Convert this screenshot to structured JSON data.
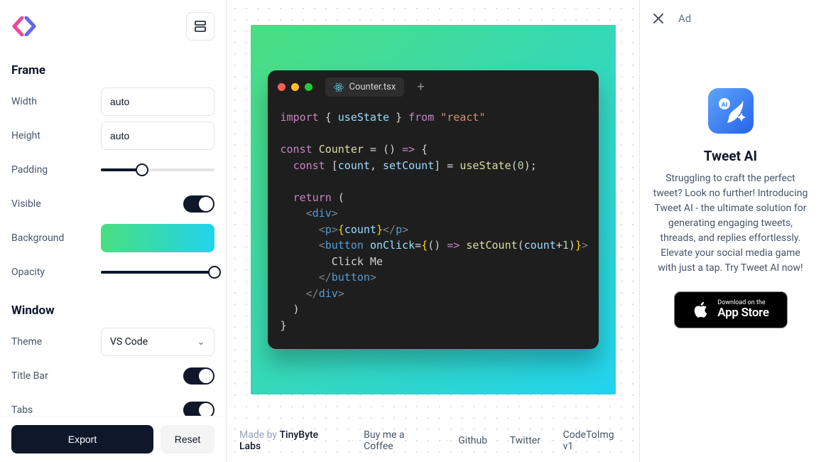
{
  "sidebar": {
    "frame": {
      "heading": "Frame",
      "width": {
        "label": "Width",
        "value": "auto"
      },
      "height": {
        "label": "Height",
        "value": "auto"
      },
      "padding": {
        "label": "Padding",
        "pct": 36
      },
      "visible": {
        "label": "Visible",
        "on": true
      },
      "background": {
        "label": "Background"
      },
      "opacity": {
        "label": "Opacity",
        "pct": 100
      }
    },
    "window": {
      "heading": "Window",
      "theme": {
        "label": "Theme",
        "value": "VS Code"
      },
      "titlebar": {
        "label": "Title Bar",
        "on": true
      },
      "tabs": {
        "label": "Tabs",
        "on": true
      }
    },
    "export": "Export",
    "reset": "Reset"
  },
  "editor": {
    "filename": "Counter.tsx",
    "code_tokens": [
      [
        [
          "kw",
          "import"
        ],
        [
          "pn",
          " { "
        ],
        [
          "id",
          "useState"
        ],
        [
          "pn",
          " } "
        ],
        [
          "kw",
          "from"
        ],
        [
          "pn",
          " "
        ],
        [
          "str",
          "\"react\""
        ]
      ],
      [],
      [
        [
          "kw",
          "const"
        ],
        [
          "pn",
          " "
        ],
        [
          "fn",
          "Counter"
        ],
        [
          "pn",
          " = () "
        ],
        [
          "kw",
          "=>"
        ],
        [
          "pn",
          " {"
        ]
      ],
      [
        [
          "pn",
          "  "
        ],
        [
          "kw",
          "const"
        ],
        [
          "pn",
          " ["
        ],
        [
          "id",
          "count"
        ],
        [
          "pn",
          ", "
        ],
        [
          "id",
          "setCount"
        ],
        [
          "pn",
          "] = "
        ],
        [
          "fn",
          "useState"
        ],
        [
          "pn",
          "("
        ],
        [
          "num",
          "0"
        ],
        [
          "pn",
          ");"
        ]
      ],
      [],
      [
        [
          "pn",
          "  "
        ],
        [
          "kw",
          "return"
        ],
        [
          "pn",
          " ("
        ]
      ],
      [
        [
          "pn",
          "    "
        ],
        [
          "gr",
          "<"
        ],
        [
          "tag",
          "div"
        ],
        [
          "gr",
          ">"
        ]
      ],
      [
        [
          "pn",
          "      "
        ],
        [
          "gr",
          "<"
        ],
        [
          "tag",
          "p"
        ],
        [
          "gr",
          ">"
        ],
        [
          "br",
          "{"
        ],
        [
          "id",
          "count"
        ],
        [
          "br",
          "}"
        ],
        [
          "gr",
          "</"
        ],
        [
          "tag",
          "p"
        ],
        [
          "gr",
          ">"
        ]
      ],
      [
        [
          "pn",
          "      "
        ],
        [
          "gr",
          "<"
        ],
        [
          "tag",
          "button"
        ],
        [
          "pn",
          " "
        ],
        [
          "id",
          "onClick"
        ],
        [
          "pn",
          "="
        ],
        [
          "br",
          "{"
        ],
        [
          "pn",
          "() "
        ],
        [
          "kw",
          "=>"
        ],
        [
          "pn",
          " "
        ],
        [
          "fn",
          "setCount"
        ],
        [
          "pn",
          "("
        ],
        [
          "id",
          "count"
        ],
        [
          "pn",
          "+"
        ],
        [
          "num",
          "1"
        ],
        [
          "pn",
          ")"
        ],
        [
          "br",
          "}"
        ],
        [
          "gr",
          ">"
        ]
      ],
      [
        [
          "w",
          "        Click Me"
        ]
      ],
      [
        [
          "pn",
          "      "
        ],
        [
          "gr",
          "</"
        ],
        [
          "tag",
          "button"
        ],
        [
          "gr",
          ">"
        ]
      ],
      [
        [
          "pn",
          "    "
        ],
        [
          "gr",
          "</"
        ],
        [
          "tag",
          "div"
        ],
        [
          "gr",
          ">"
        ]
      ],
      [
        [
          "pn",
          "  )"
        ]
      ],
      [
        [
          "pn",
          "}"
        ]
      ]
    ]
  },
  "bottombar": {
    "made": "Made by ",
    "author": "TinyByte Labs",
    "links": [
      "Buy me a Coffee",
      "Github",
      "Twitter",
      "CodeToImg v1"
    ]
  },
  "ad": {
    "label": "Ad",
    "title": "Tweet AI",
    "desc": "Struggling to craft the perfect tweet? Look no further! Introducing Tweet AI - the ultimate solution for generating engaging tweets, threads, and replies effortlessly. Elevate your social media game with just a tap. Try Tweet AI now!",
    "store_t1": "Download on the",
    "store_t2": "App Store"
  }
}
